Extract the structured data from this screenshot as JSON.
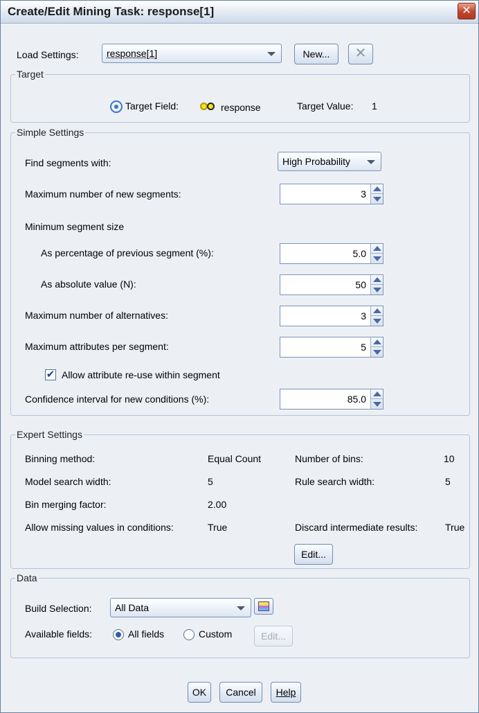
{
  "window": {
    "title": "Create/Edit Mining Task: response[1]"
  },
  "load": {
    "label": "Load Settings:",
    "value": "response[1]",
    "new_label": "New..."
  },
  "target": {
    "legend": "Target",
    "field_label": "Target Field:",
    "field_value": "response",
    "value_label": "Target Value:",
    "value": "1"
  },
  "simple": {
    "legend": "Simple Settings",
    "find_label": "Find segments with:",
    "find_value": "High Probability",
    "max_new_label": "Maximum number of new segments:",
    "max_new_value": "3",
    "min_size_label": "Minimum segment size",
    "pct_label": "As percentage of previous segment (%):",
    "pct_value": "5.0",
    "abs_label": "As absolute value (N):",
    "abs_value": "50",
    "max_alt_label": "Maximum number of alternatives:",
    "max_alt_value": "3",
    "max_attr_label": "Maximum attributes per segment:",
    "max_attr_value": "5",
    "reuse_label": "Allow attribute re-use within segment",
    "reuse_checked": true,
    "conf_label": "Confidence interval for new conditions (%):",
    "conf_value": "85.0"
  },
  "expert": {
    "legend": "Expert Settings",
    "binning_label": "Binning method:",
    "binning_value": "Equal Count",
    "bins_label": "Number of bins:",
    "bins_value": "10",
    "model_width_label": "Model search width:",
    "model_width_value": "5",
    "rule_width_label": "Rule search width:",
    "rule_width_value": "5",
    "merge_label": "Bin merging factor:",
    "merge_value": "2.00",
    "missing_label": "Allow missing values in conditions:",
    "missing_value": "True",
    "discard_label": "Discard intermediate results:",
    "discard_value": "True",
    "edit_label": "Edit..."
  },
  "data": {
    "legend": "Data",
    "build_label": "Build Selection:",
    "build_value": "All Data",
    "fields_label": "Available fields:",
    "all_fields_label": "All fields",
    "custom_label": "Custom",
    "edit_label": "Edit...",
    "all_fields_selected": true
  },
  "buttons": {
    "ok": "OK",
    "cancel": "Cancel",
    "help": "Help"
  },
  "icons": {
    "close": "close-icon",
    "delete": "x-delete-icon",
    "target": "target-icon",
    "flag": "flag-field-icon",
    "selection": "selection-icon"
  }
}
